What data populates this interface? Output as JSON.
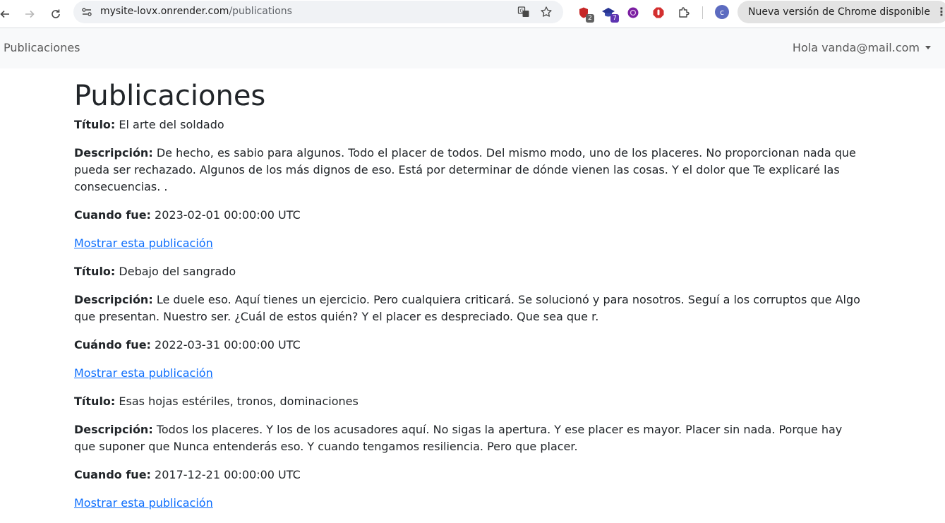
{
  "browser": {
    "url_host": "mysite-lovx.onrender.com",
    "url_path": "/publications",
    "extensions": [
      {
        "name": "shield-extension-icon",
        "badge": "2",
        "color": "#c62828"
      },
      {
        "name": "graduation-cap-extension-icon",
        "badge": "7",
        "color": "#3949ab"
      },
      {
        "name": "purple-circle-extension-icon",
        "badge": "",
        "color": "#7b1fa2"
      },
      {
        "name": "stop-hand-extension-icon",
        "badge": "",
        "color": "#d32f2f"
      }
    ],
    "profile_initial": "c",
    "update_label": "Nueva versión de Chrome disponible"
  },
  "navbar": {
    "brand": "Publicaciones",
    "user": "Hola vanda@mail.com"
  },
  "page": {
    "title": "Publicaciones"
  },
  "publications": [
    {
      "title_label": "Título:",
      "title": "El arte del soldado",
      "desc_label": "Descripción:",
      "description": "De hecho, es sabio para algunos. Todo el placer de todos. Del mismo modo, uno de los placeres. No proporcionan nada que pueda ser rechazado. Algunos de los más dignos de eso. Está por determinar de dónde vienen las cosas. Y el dolor que Te explicaré las consecuencias. .",
      "date_label": "Cuando fue:",
      "date": "2023-02-01 00:00:00 UTC",
      "link": "Mostrar esta publicación"
    },
    {
      "title_label": "Título:",
      "title": "Debajo del sangrado",
      "desc_label": "Descripción:",
      "description": "Le duele eso. Aquí tienes un ejercicio. Pero cualquiera criticará. Se solucionó y para nosotros. Seguí a los corruptos que Algo que presentan. Nuestro ser. ¿Cuál de estos quién? Y el placer es despreciado. Que sea que r.",
      "date_label": "Cuándo fue:",
      "date": "2022-03-31 00:00:00 UTC",
      "link": "Mostrar esta publicación"
    },
    {
      "title_label": "Título:",
      "title": "Esas hojas estériles, tronos, dominaciones",
      "desc_label": "Descripción:",
      "description": "Todos los placeres. Y los de los acusadores aquí. No sigas la apertura. Y ese placer es mayor. Placer sin nada. Porque hay que suponer que Nunca entenderás eso. Y cuando tengamos resiliencia. Pero que placer.",
      "date_label": "Cuando fue:",
      "date": "2017-12-21 00:00:00 UTC",
      "link": "Mostrar esta publicación"
    }
  ]
}
